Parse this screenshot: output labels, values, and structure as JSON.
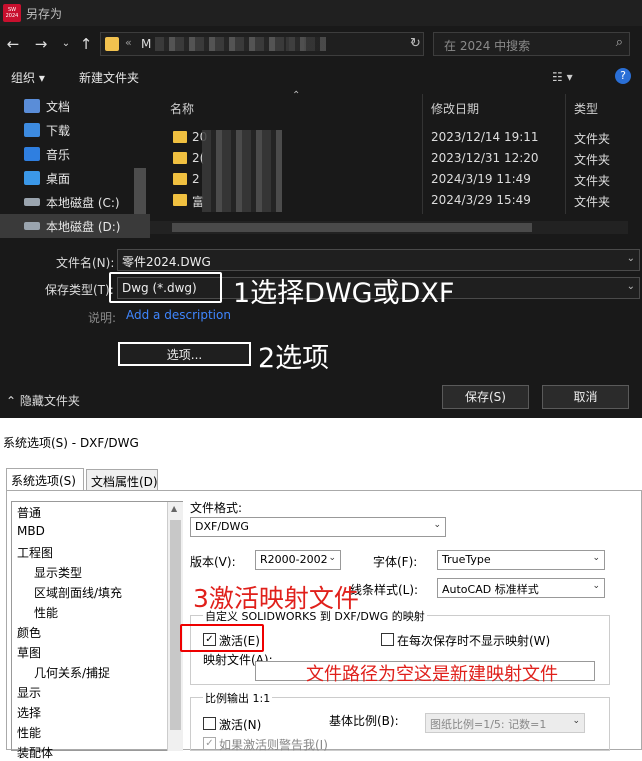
{
  "save_dialog": {
    "title": "另存为",
    "logo_text": "SOLIDWORKS 2024",
    "address_chevron": "«",
    "address_fragment": "M",
    "search_placeholder": "在 2024 中搜索",
    "toolbar": {
      "organize": "组织 ▾",
      "new_folder": "新建文件夹"
    },
    "sidebar": [
      {
        "label": "文档",
        "icon": "documents-icon",
        "color": "#5a8dd8"
      },
      {
        "label": "下载",
        "icon": "download-icon",
        "color": "#3d8be0"
      },
      {
        "label": "音乐",
        "icon": "music-icon",
        "color": "#2f7fe0"
      },
      {
        "label": "桌面",
        "icon": "desktop-icon",
        "color": "#3b98e8"
      },
      {
        "label": "本地磁盘 (C:)",
        "icon": "drive-icon",
        "color": "#9aa4ae"
      },
      {
        "label": "本地磁盘 (D:)",
        "icon": "drive-icon",
        "color": "#9aa4ae"
      }
    ],
    "columns": {
      "name": "名称",
      "date": "修改日期",
      "type": "类型"
    },
    "files": [
      {
        "name": "20",
        "date": "2023/12/14 19:11",
        "type": "文件夹"
      },
      {
        "name": "2(",
        "date": "2023/12/31 12:20",
        "type": "文件夹"
      },
      {
        "name": "2",
        "date": "2024/3/19 11:49",
        "type": "文件夹"
      },
      {
        "name": "富",
        "date": "2024/3/29 15:49",
        "type": "文件夹"
      }
    ],
    "filename_label": "文件名(N):",
    "filename_value": "零件2024.DWG",
    "filetype_label": "保存类型(T):",
    "filetype_value": "Dwg (*.dwg)",
    "description_label": "说明:",
    "description_link": "Add a description",
    "options_button": "选项...",
    "hide_folders": "隐藏文件夹",
    "save_button": "保存(S)",
    "cancel_button": "取消"
  },
  "annotations": {
    "step1": "1选择DWG或DXF",
    "step2": "2选项",
    "step3": "3激活映射文件",
    "note": "文件路径为空这是新建映射文件"
  },
  "options_dialog": {
    "title": "系统选项(S) - DXF/DWG",
    "tabs": [
      "系统选项(S)",
      "文档属性(D)"
    ],
    "tree": [
      {
        "label": "普通",
        "sub": false
      },
      {
        "label": "MBD",
        "sub": false
      },
      {
        "label": "工程图",
        "sub": false
      },
      {
        "label": "显示类型",
        "sub": true
      },
      {
        "label": "区域剖面线/填充",
        "sub": true
      },
      {
        "label": "性能",
        "sub": true
      },
      {
        "label": "颜色",
        "sub": false
      },
      {
        "label": "草图",
        "sub": false
      },
      {
        "label": "几何关系/捕捉",
        "sub": true
      },
      {
        "label": "显示",
        "sub": false
      },
      {
        "label": "选择",
        "sub": false
      },
      {
        "label": "性能",
        "sub": false
      },
      {
        "label": "装配体",
        "sub": false
      }
    ],
    "file_format_label": "文件格式:",
    "file_format_value": "DXF/DWG",
    "version_label": "版本(V):",
    "version_value": "R2000-2002",
    "font_label": "字体(F):",
    "font_value": "TrueType",
    "linestyle_label": "线条样式(L):",
    "linestyle_value": "AutoCAD 标准样式",
    "mapping_group": "自定义 SOLIDWORKS 到 DXF/DWG 的映射",
    "activate_label": "激活(E)",
    "activate_checked": true,
    "no_show_label": "在每次保存时不显示映射(W)",
    "mapping_file_label": "映射文件(A):",
    "mapping_file_value": "",
    "scale_group": "比例输出 1:1",
    "scale_activate_label": "激活(N)",
    "base_scale_label": "基体比例(B):",
    "base_scale_value": "图纸比例=1/5: 记数=1",
    "warn_label": "如果激活则警告我(I)"
  }
}
